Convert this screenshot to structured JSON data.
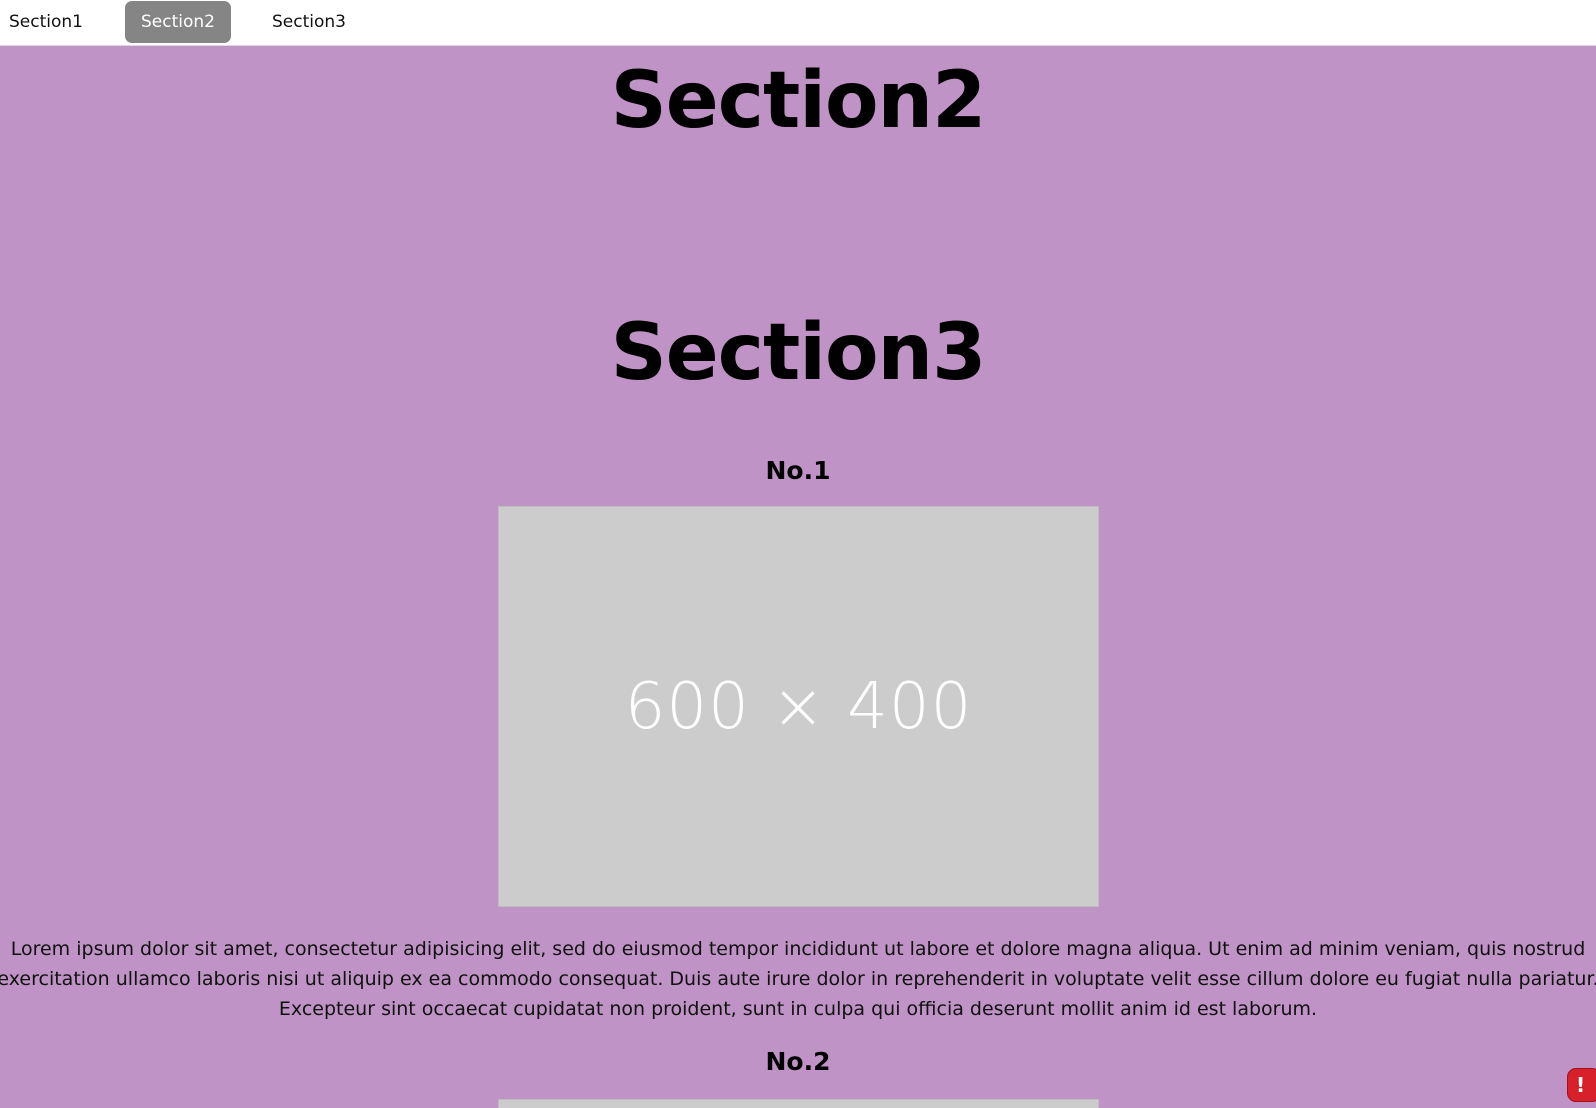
{
  "nav": {
    "items": [
      {
        "label": "Section1"
      },
      {
        "label": "Section2"
      },
      {
        "label": "Section3"
      }
    ],
    "active_index": 1
  },
  "sections": {
    "section2": {
      "title": "Section2"
    },
    "section3": {
      "title": "Section3",
      "items": [
        {
          "heading": "No.1",
          "image_label": "600 × 400",
          "text": "Lorem ipsum dolor sit amet, consectetur adipisicing elit, sed do eiusmod tempor incididunt ut labore et dolore magna aliqua. Ut enim ad minim veniam, quis nostrud exercitation ullamco laboris nisi ut aliquip ex ea commodo consequat. Duis aute irure dolor in reprehenderit in voluptate velit esse cillum dolore eu fugiat nulla pariatur. Excepteur sint occaecat cupidatat non proident, sunt in culpa qui officia deserunt mollit anim id est laborum."
        },
        {
          "heading": "No.2"
        }
      ]
    }
  },
  "error_badge": {
    "icon": "exclamation-icon",
    "glyph": "!"
  },
  "colors": {
    "background": "#bf93c5",
    "nav_active": "#858585",
    "placeholder": "#cccccc",
    "error": "#d8202a"
  }
}
